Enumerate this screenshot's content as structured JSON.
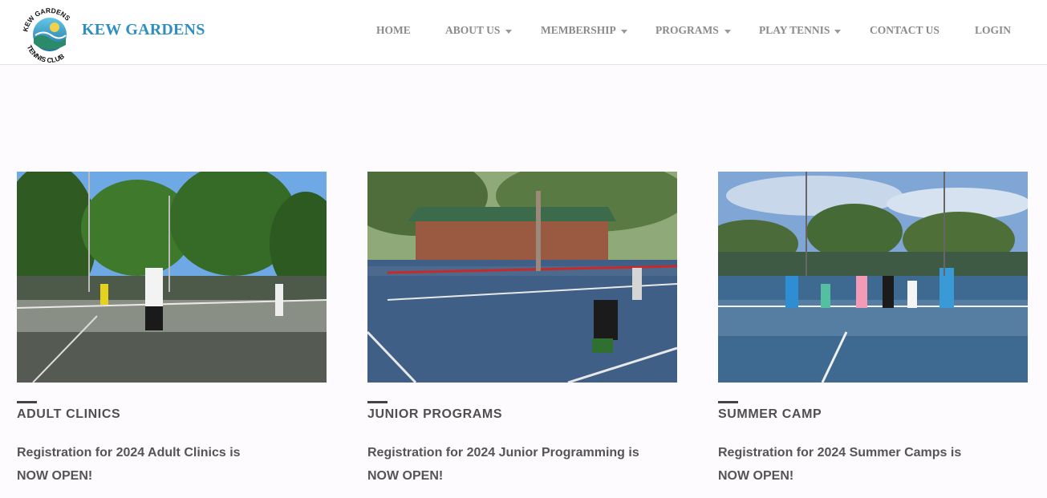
{
  "header": {
    "brand": "KEW GARDENS",
    "logo_text": "KEW GARDENS TENNIS CLUB",
    "colors": {
      "brand": "#2e8fc0",
      "nav": "#8a8a8a"
    }
  },
  "nav": {
    "home": "HOME",
    "about": "ABOUT US",
    "membership": "MEMBERSHIP",
    "programs": "PROGRAMS",
    "play": "PLAY TENNIS",
    "contact": "CONTACT US",
    "login": "LOGIN",
    "dropdown_icon": "chevron-down-icon"
  },
  "cards": [
    {
      "title": "ADULT CLINICS",
      "line1": "Registration for 2024 Adult Clinics is",
      "line2": "NOW OPEN!",
      "image": "adult tennis clinic photo"
    },
    {
      "title": "JUNIOR PROGRAMS",
      "line1": "Registration for 2024 Junior Programming is",
      "line2": "NOW OPEN!",
      "image": "junior tennis program photo"
    },
    {
      "title": "SUMMER CAMP",
      "line1": "Registration for 2024 Summer Camps is",
      "line2": "NOW OPEN!",
      "image": "summer camp group photo"
    }
  ]
}
